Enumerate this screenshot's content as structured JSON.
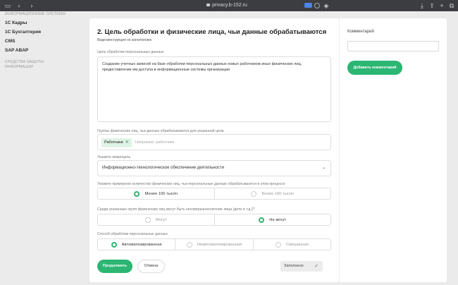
{
  "browser": {
    "url": "privacy.b-152.ru"
  },
  "sidebar": {
    "top_muted": "ИНФОРМАЦИОННЫЕ СИСТЕМЫ",
    "items": [
      "1С Кадры",
      "1С Бухгалтерия",
      "CMS",
      "SAP ABAP"
    ],
    "bottom_muted_1": "СРЕДСТВА ЗАЩИТЫ",
    "bottom_muted_2": "ИНФОРМАЦИИ"
  },
  "form": {
    "title": "2. Цель обработки и физические лица, чьи данные обрабатываются",
    "video_link": "Видеоинструкция по заполнению",
    "purpose_label": "Цель обработки персональных данных",
    "purpose_value": "Создание учетных записей на базе обработки персональных данных новых работников иных физических лиц, предоставление им доступа в информационные системы организации",
    "groups_label": "Группы физических лиц, чьи данные обрабатываются для указанной цели",
    "groups_tag": "Работники",
    "groups_placeholder": "Например: работники",
    "macro_label": "Укажите макроцель",
    "macro_value": "Информационно-технологическое обеспечение деятельности",
    "count_label": "Укажите примерное количество физических лиц, чьи персональные данные обрабатываются в этом процессе",
    "count_options": [
      "Менее 100 тысяч",
      "Более 100 тысяч"
    ],
    "count_selected": 0,
    "minors_label": "Среди указанных групп физических лиц могут быть несовершеннолетние лица (дети и т.д.)?",
    "minors_options": [
      "Могут",
      "Не могут"
    ],
    "minors_selected": 1,
    "method_label": "Способ обработки персональных данных",
    "method_options": [
      "Автоматизированная",
      "Неавтоматизированная",
      "Смешанная"
    ],
    "method_selected": 0,
    "continue_button": "Продолжить",
    "cancel_button": "Отмена",
    "filled_label": "Заполнено"
  },
  "comments": {
    "title": "Комментарий",
    "add_button": "Добавить комментарий"
  },
  "colors": {
    "accent": "#2bb673"
  }
}
